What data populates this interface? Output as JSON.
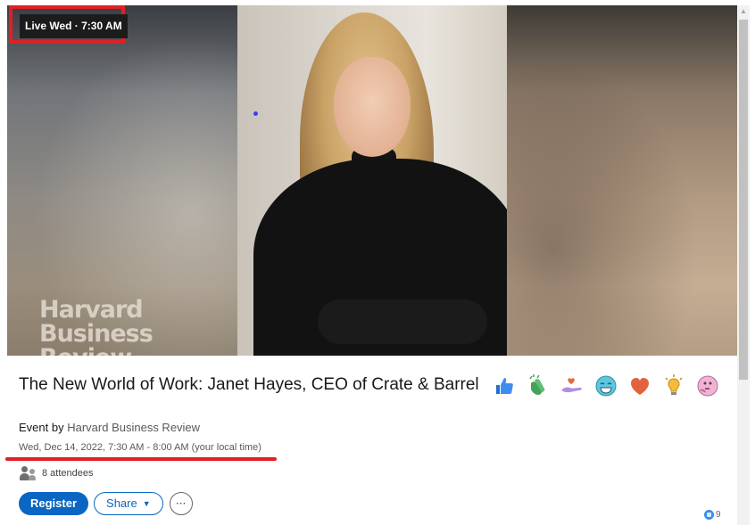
{
  "live_badge": "Live Wed · 7:30 AM",
  "hero": {
    "logo_lines": [
      "Harvard",
      "Business",
      "Review"
    ]
  },
  "event": {
    "title": "The New World of Work: Janet Hayes, CEO of Crate & Barrel",
    "event_by_prefix": "Event by",
    "organizer": "Harvard Business Review",
    "datetime": "Wed, Dec 14, 2022, 7:30 AM - 8:00 AM (your local time)",
    "attendees": "8 attendees"
  },
  "actions": {
    "register": "Register",
    "share": "Share",
    "more": "···"
  },
  "reactions": [
    {
      "icon": "thumbs-up-icon"
    },
    {
      "icon": "clapping-hands-icon"
    },
    {
      "icon": "support-heart-hand-icon"
    },
    {
      "icon": "laughing-face-icon"
    },
    {
      "icon": "heart-icon"
    },
    {
      "icon": "lightbulb-icon"
    },
    {
      "icon": "thinking-face-icon"
    }
  ],
  "like_count": "9",
  "colors": {
    "accent": "#0a66c2",
    "annotation_red": "#e01f26"
  }
}
